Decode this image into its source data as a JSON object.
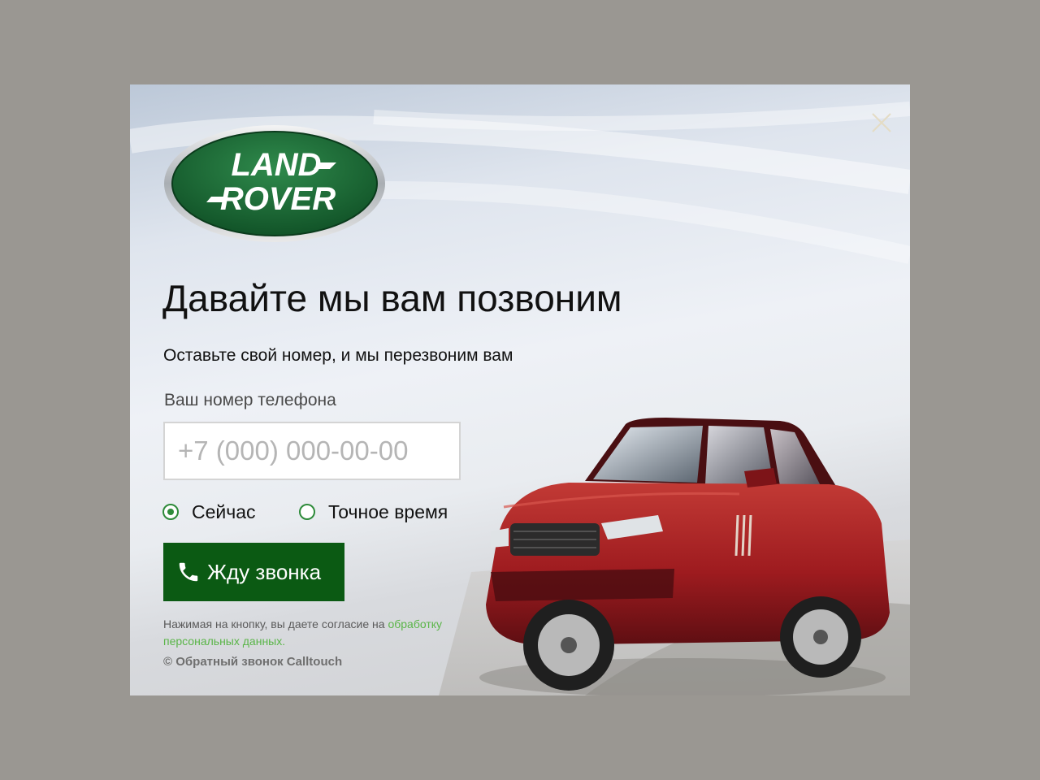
{
  "modal": {
    "close_icon": "close-icon",
    "logo": {
      "brand_line1": "LAND",
      "brand_line2": "ROVER"
    },
    "title": "Давайте мы вам позвоним",
    "subtitle": "Оставьте свой номер, и мы перезвоним вам",
    "phone": {
      "label": "Ваш номер телефона",
      "placeholder": "+7 (000) 000-00-00",
      "value": ""
    },
    "call_time": {
      "options": [
        {
          "label": "Сейчас",
          "selected": true
        },
        {
          "label": "Точное время",
          "selected": false
        }
      ]
    },
    "submit_label": "Жду звонка",
    "submit_icon": "phone-icon",
    "consent": {
      "text": "Нажимая на кнопку, вы даете согласие на ",
      "link": "обработку персональных данных."
    },
    "copyright": "© Обратный звонок Calltouch",
    "colors": {
      "accent": "#0b5a13",
      "radio": "#2e8b3a",
      "link": "#5ab548",
      "logo_green": "#1d6b35",
      "car_red": "#9e1b1f",
      "overlay": "#9a9792"
    }
  }
}
